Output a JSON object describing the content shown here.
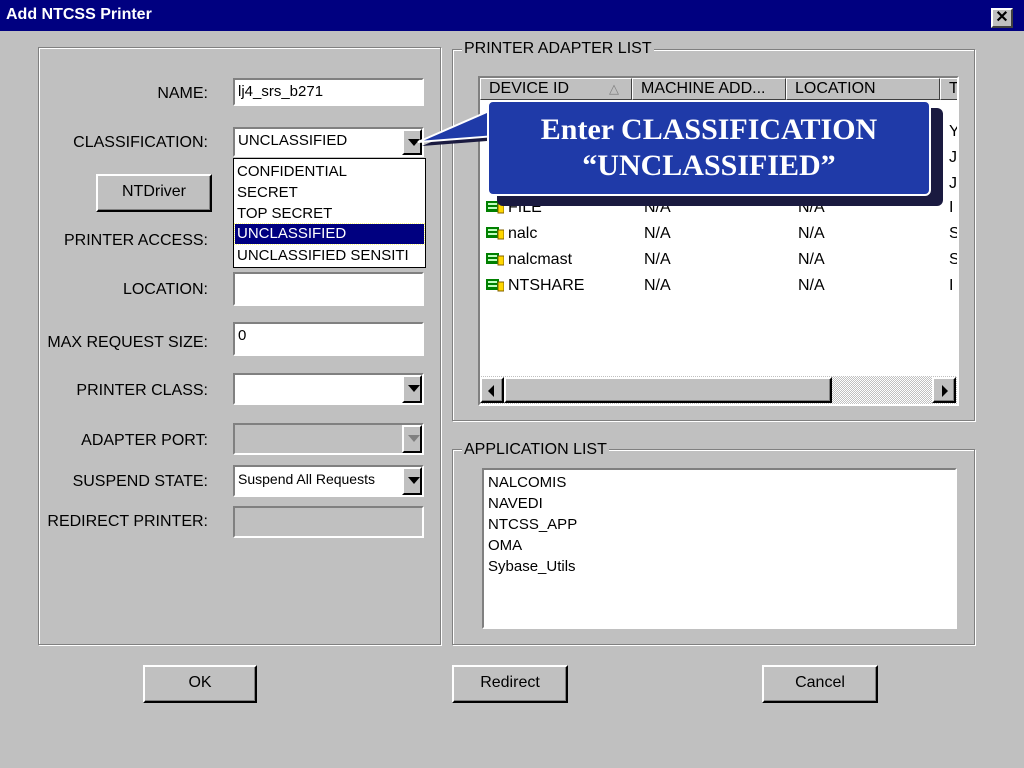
{
  "window": {
    "title": "Add NTCSS Printer",
    "close_glyph": "✕"
  },
  "form": {
    "name_label": "NAME:",
    "name_value": "lj4_srs_b271",
    "classification_label": "CLASSIFICATION:",
    "classification_value": "UNCLASSIFIED",
    "classification_options": [
      "CONFIDENTIAL",
      "SECRET",
      "TOP SECRET",
      "UNCLASSIFIED",
      "UNCLASSIFIED SENSITI"
    ],
    "classification_selected_index": 3,
    "ntdriver_button": "NTDriver",
    "printer_access_label": "PRINTER ACCESS:",
    "location_label": "LOCATION:",
    "location_value": "",
    "max_request_label": "MAX REQUEST SIZE:",
    "max_request_value": "0",
    "printer_class_label": "PRINTER CLASS:",
    "printer_class_value": "",
    "adapter_port_label": "ADAPTER PORT:",
    "adapter_port_value": "",
    "suspend_state_label": "SUSPEND STATE:",
    "suspend_state_value": "Suspend All Requests",
    "redirect_printer_label": "REDIRECT PRINTER:",
    "redirect_printer_value": ""
  },
  "adapter_list": {
    "legend": "PRINTER ADAPTER LIST",
    "columns": [
      "DEVICE ID",
      "MACHINE ADD...",
      "LOCATION",
      "T"
    ],
    "sort_indicator": "△",
    "rows": [
      {
        "device": "FILE",
        "machine": "N/A",
        "location": "N/A",
        "type": "I"
      },
      {
        "device": "nalc",
        "machine": "N/A",
        "location": "N/A",
        "type": "S"
      },
      {
        "device": "nalcmast",
        "machine": "N/A",
        "location": "N/A",
        "type": "S"
      },
      {
        "device": "NTSHARE",
        "machine": "N/A",
        "location": "N/A",
        "type": "I"
      }
    ],
    "partial_types": [
      "Y",
      "J",
      "J"
    ]
  },
  "application_list": {
    "legend": "APPLICATION LIST",
    "items": [
      "NALCOMIS",
      "NAVEDI",
      "NTCSS_APP",
      "OMA",
      "Sybase_Utils"
    ]
  },
  "buttons": {
    "ok": "OK",
    "redirect": "Redirect",
    "cancel": "Cancel"
  },
  "callout": {
    "line1": "Enter CLASSIFICATION",
    "line2": "“UNCLASSIFIED”"
  },
  "colors": {
    "title_bar": "#000080",
    "selection": "#000080",
    "callout_bg": "#1f3aa8",
    "dialog_bg": "#c0c0c0"
  }
}
